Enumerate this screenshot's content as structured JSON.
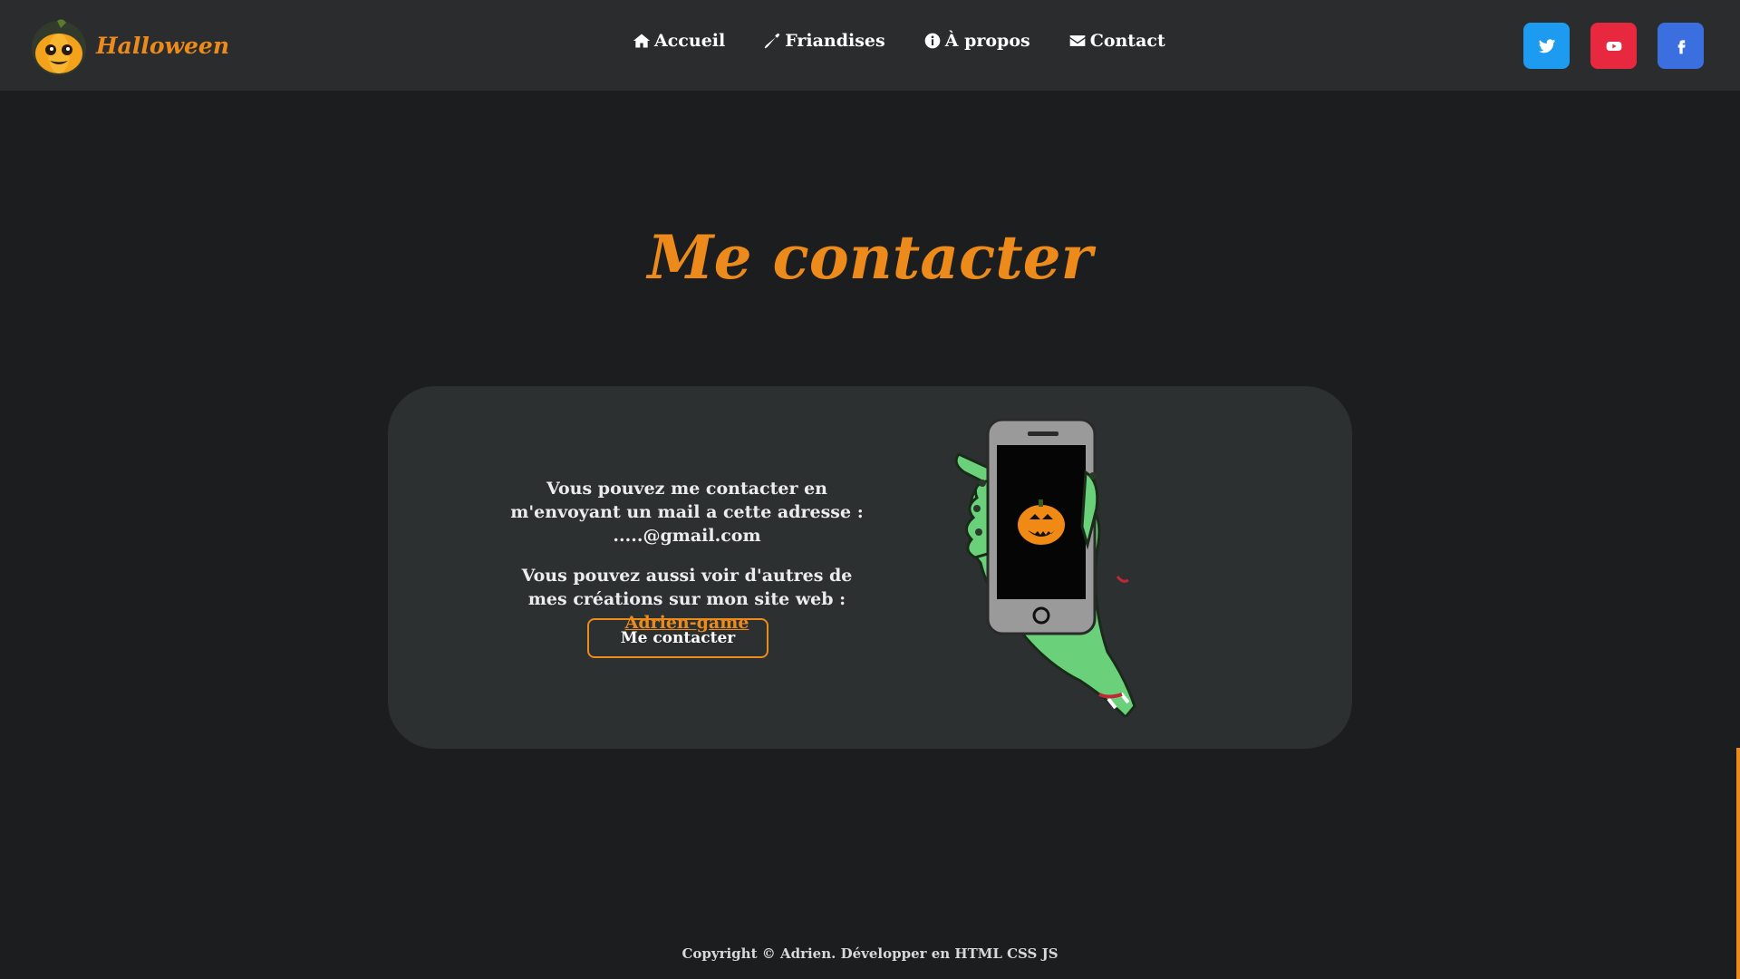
{
  "brand": {
    "name": "Halloween",
    "logo_icon": "pumpkin-logo-icon"
  },
  "nav": {
    "items": [
      {
        "label": "Accueil",
        "icon": "home-icon"
      },
      {
        "label": "Friandises",
        "icon": "candy-icon"
      },
      {
        "label": "À propos",
        "icon": "info-icon"
      },
      {
        "label": "Contact",
        "icon": "envelope-icon"
      }
    ]
  },
  "socials": [
    {
      "name": "twitter",
      "icon": "twitter-icon",
      "color": "#1d9bf0"
    },
    {
      "name": "youtube",
      "icon": "youtube-icon",
      "color": "#e8283f"
    },
    {
      "name": "facebook",
      "icon": "facebook-icon",
      "color": "#3b6fe0"
    }
  ],
  "main": {
    "title": "Me contacter",
    "paragraph1": "Vous pouvez me contacter en m'envoyant un mail a cette adresse : .....@gmail.com",
    "paragraph2_prefix": "Vous pouvez aussi voir d'autres de mes créations sur mon site web : ",
    "paragraph2_link": "Adrien-game",
    "button_label": "Me contacter",
    "illustration": "zombie-hand-phone-pumpkin"
  },
  "footer": {
    "text": "Copyright © Adrien. Développer en HTML CSS JS"
  },
  "colors": {
    "accent": "#ec8a1b",
    "background": "#1b1d1e",
    "header": "#2a2c2d",
    "card": "#2d3031"
  }
}
